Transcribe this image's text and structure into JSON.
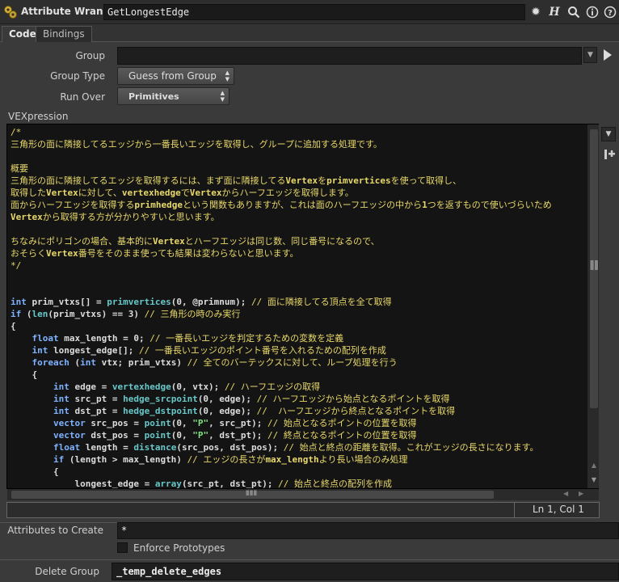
{
  "header": {
    "node_type": "Attribute Wrangle",
    "node_name": "GetLongestEdge",
    "icons": [
      "gear-icon",
      "help-h-icon",
      "search-icon",
      "info-icon",
      "help-icon"
    ]
  },
  "tabs": [
    {
      "label": "Code",
      "active": true
    },
    {
      "label": "Bindings",
      "active": false
    }
  ],
  "parms": {
    "group_label": "Group",
    "group_value": "",
    "group_type_label": "Group Type",
    "group_type_value": "Guess from Group",
    "run_over_label": "Run Over",
    "run_over_value": "Primitives",
    "vexpression_label": "VEXpression"
  },
  "code_lines": [
    [
      [
        "cmt",
        "/*"
      ]
    ],
    [
      [
        "cmt",
        "三角形の面に隣接してるエッジから一番長いエッジを取得し、グループに追加する処理です。"
      ]
    ],
    [],
    [
      [
        "cmt",
        "概要"
      ]
    ],
    [
      [
        "cmt",
        "三角形の面に隣接してるエッジを取得するには、まず面に隣接してる"
      ],
      [
        "bo",
        "Vertex"
      ],
      [
        "cmt",
        "を"
      ],
      [
        "bo",
        "primvertices"
      ],
      [
        "cmt",
        "を使って取得し、"
      ]
    ],
    [
      [
        "cmt",
        "取得した"
      ],
      [
        "bo",
        "Vertex"
      ],
      [
        "cmt",
        "に対して、"
      ],
      [
        "bo",
        "vertexhedge"
      ],
      [
        "cmt",
        "で"
      ],
      [
        "bo",
        "Vertex"
      ],
      [
        "cmt",
        "からハーフエッジを取得します。"
      ]
    ],
    [
      [
        "cmt",
        "面からハーフエッジを取得する"
      ],
      [
        "bo",
        "primhedge"
      ],
      [
        "cmt",
        "という関数もありますが、これは面のハーフエッジの中から"
      ],
      [
        "bo",
        "1"
      ],
      [
        "cmt",
        "つを返すもので使いづらいため"
      ]
    ],
    [
      [
        "bo",
        "Vertex"
      ],
      [
        "cmt",
        "から取得する方が分かりやすいと思います。"
      ]
    ],
    [],
    [
      [
        "cmt",
        "ちなみにポリゴンの場合、基本的に"
      ],
      [
        "bo",
        "Vertex"
      ],
      [
        "cmt",
        "とハーフエッジは同じ数、同じ番号になるので、"
      ]
    ],
    [
      [
        "cmt",
        "おそらく"
      ],
      [
        "bo",
        "Vertex"
      ],
      [
        "cmt",
        "番号をそのまま使っても結果は変わらないと思います。"
      ]
    ],
    [
      [
        "cmt",
        "*/"
      ]
    ],
    [],
    [],
    [
      [
        "kw",
        "int"
      ],
      [
        "id",
        " prim_vtxs[] = "
      ],
      [
        "fn",
        "primvertices"
      ],
      [
        "id",
        "(0, @primnum); "
      ],
      [
        "cmt",
        "// 面に隣接してる頂点を全て取得"
      ]
    ],
    [
      [
        "kw",
        "if"
      ],
      [
        "id",
        " ("
      ],
      [
        "fn",
        "len"
      ],
      [
        "id",
        "(prim_vtxs) == 3) "
      ],
      [
        "cmt",
        "// 三角形の時のみ実行"
      ]
    ],
    [
      [
        "id",
        "{"
      ]
    ],
    [
      [
        "id",
        "    "
      ],
      [
        "kw",
        "float"
      ],
      [
        "id",
        " max_length = 0; "
      ],
      [
        "cmt",
        "// 一番長いエッジを判定するための変数を定義"
      ]
    ],
    [
      [
        "id",
        "    "
      ],
      [
        "kw",
        "int"
      ],
      [
        "id",
        " longest_edge[]; "
      ],
      [
        "cmt",
        "// 一番長いエッジのポイント番号を入れるための配列を作成"
      ]
    ],
    [
      [
        "id",
        "    "
      ],
      [
        "kw",
        "foreach"
      ],
      [
        "id",
        " ("
      ],
      [
        "kw",
        "int"
      ],
      [
        "id",
        " vtx; prim_vtxs) "
      ],
      [
        "cmt",
        "// 全てのバーテックスに対して、ループ処理を行う"
      ]
    ],
    [
      [
        "id",
        "    {"
      ]
    ],
    [
      [
        "id",
        "        "
      ],
      [
        "kw",
        "int"
      ],
      [
        "id",
        " edge = "
      ],
      [
        "fn",
        "vertexhedge"
      ],
      [
        "id",
        "(0, vtx); "
      ],
      [
        "cmt",
        "// ハーフエッジの取得"
      ]
    ],
    [
      [
        "id",
        "        "
      ],
      [
        "kw",
        "int"
      ],
      [
        "id",
        " src_pt = "
      ],
      [
        "fn",
        "hedge_srcpoint"
      ],
      [
        "id",
        "(0, edge); "
      ],
      [
        "cmt",
        "// ハーフエッジから始点となるポイントを取得"
      ]
    ],
    [
      [
        "id",
        "        "
      ],
      [
        "kw",
        "int"
      ],
      [
        "id",
        " dst_pt = "
      ],
      [
        "fn",
        "hedge_dstpoint"
      ],
      [
        "id",
        "(0, edge); "
      ],
      [
        "cmt",
        "//  ハーフエッジから終点となるポイントを取得"
      ]
    ],
    [
      [
        "id",
        "        "
      ],
      [
        "kw",
        "vector"
      ],
      [
        "id",
        " src_pos = "
      ],
      [
        "fn",
        "point"
      ],
      [
        "id",
        "(0, "
      ],
      [
        "str",
        "\"P\""
      ],
      [
        "id",
        ", src_pt); "
      ],
      [
        "cmt",
        "// 始点となるポイントの位置を取得"
      ]
    ],
    [
      [
        "id",
        "        "
      ],
      [
        "kw",
        "vector"
      ],
      [
        "id",
        " dst_pos = "
      ],
      [
        "fn",
        "point"
      ],
      [
        "id",
        "(0, "
      ],
      [
        "str",
        "\"P\""
      ],
      [
        "id",
        ", dst_pt); "
      ],
      [
        "cmt",
        "// 終点となるポイントの位置を取得"
      ]
    ],
    [
      [
        "id",
        "        "
      ],
      [
        "kw",
        "float"
      ],
      [
        "id",
        " length = "
      ],
      [
        "fn",
        "distance"
      ],
      [
        "id",
        "(src_pos, dst_pos); "
      ],
      [
        "cmt",
        "// 始点と終点の距離を取得。これがエッジの長さになります。"
      ]
    ],
    [
      [
        "id",
        "        "
      ],
      [
        "kw",
        "if"
      ],
      [
        "id",
        " (length > max_length) "
      ],
      [
        "cmt",
        "// エッジの長さが"
      ],
      [
        "bo",
        "max_length"
      ],
      [
        "cmt",
        "より長い場合のみ処理"
      ]
    ],
    [
      [
        "id",
        "        {"
      ]
    ],
    [
      [
        "id",
        "            longest_edge = "
      ],
      [
        "fn",
        "array"
      ],
      [
        "id",
        "(src_pt, dst_pt); "
      ],
      [
        "cmt",
        "// 始点と終点の配列を作成"
      ]
    ]
  ],
  "status": {
    "cursor": "Ln 1, Col 1"
  },
  "attributes_to_create": {
    "label": "Attributes to Create",
    "value": "*"
  },
  "enforce_prototypes": {
    "label": "Enforce Prototypes",
    "checked": false
  },
  "delete_group": {
    "label": "Delete Group",
    "value": "_temp_delete_edges"
  }
}
